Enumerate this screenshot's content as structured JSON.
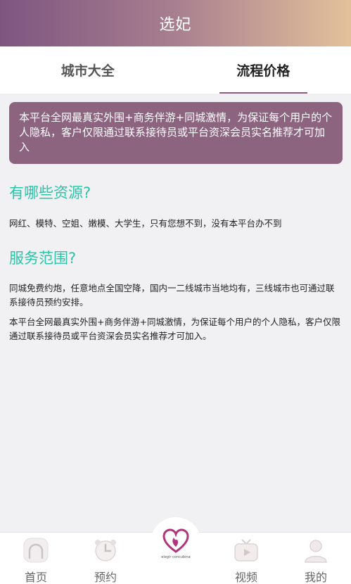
{
  "header": {
    "title": "选妃"
  },
  "tabs": [
    {
      "label": "城市大全",
      "active": false
    },
    {
      "label": "流程价格",
      "active": true
    }
  ],
  "notice": {
    "text": "本平台全网最真实外围+商务伴游+同城激情，为保证每个用户的个人隐私，客户仅限通过联系接待员或平台资深会员实名推荐才可加入"
  },
  "sections": [
    {
      "title": "有哪些资源?",
      "paragraphs": [
        "网红、模特、空姐、嫩模、大学生，只有您想不到，没有本平台办不到"
      ]
    },
    {
      "title": "服务范围?",
      "paragraphs": [
        "同城免费约炮，任意地点全国空降，国内一二线城市当地均有，三线城市也可通过联系接待员预约安排。",
        "本平台全网最真实外围+商务伴游+同城激情，为保证每个用户的个人隐私，客户仅限通过联系接待员或平台资深会员实名推荐才可加入。"
      ]
    }
  ],
  "bottom_nav": [
    {
      "label": "首页",
      "icon": "home-icon"
    },
    {
      "label": "预约",
      "icon": "alarm-clock-icon"
    },
    {
      "label": "elegir concubina",
      "icon": "heart-logo-icon"
    },
    {
      "label": "视频",
      "icon": "tv-icon"
    },
    {
      "label": "我的",
      "icon": "user-icon"
    }
  ],
  "colors": {
    "header_gradient_start": "#7e5580",
    "header_gradient_end": "#e3c19b",
    "notice_bg": "#8c6480",
    "section_title": "#2ac4a8",
    "tab_underline": "#8a5d80",
    "logo_heart": "#b0357c"
  }
}
